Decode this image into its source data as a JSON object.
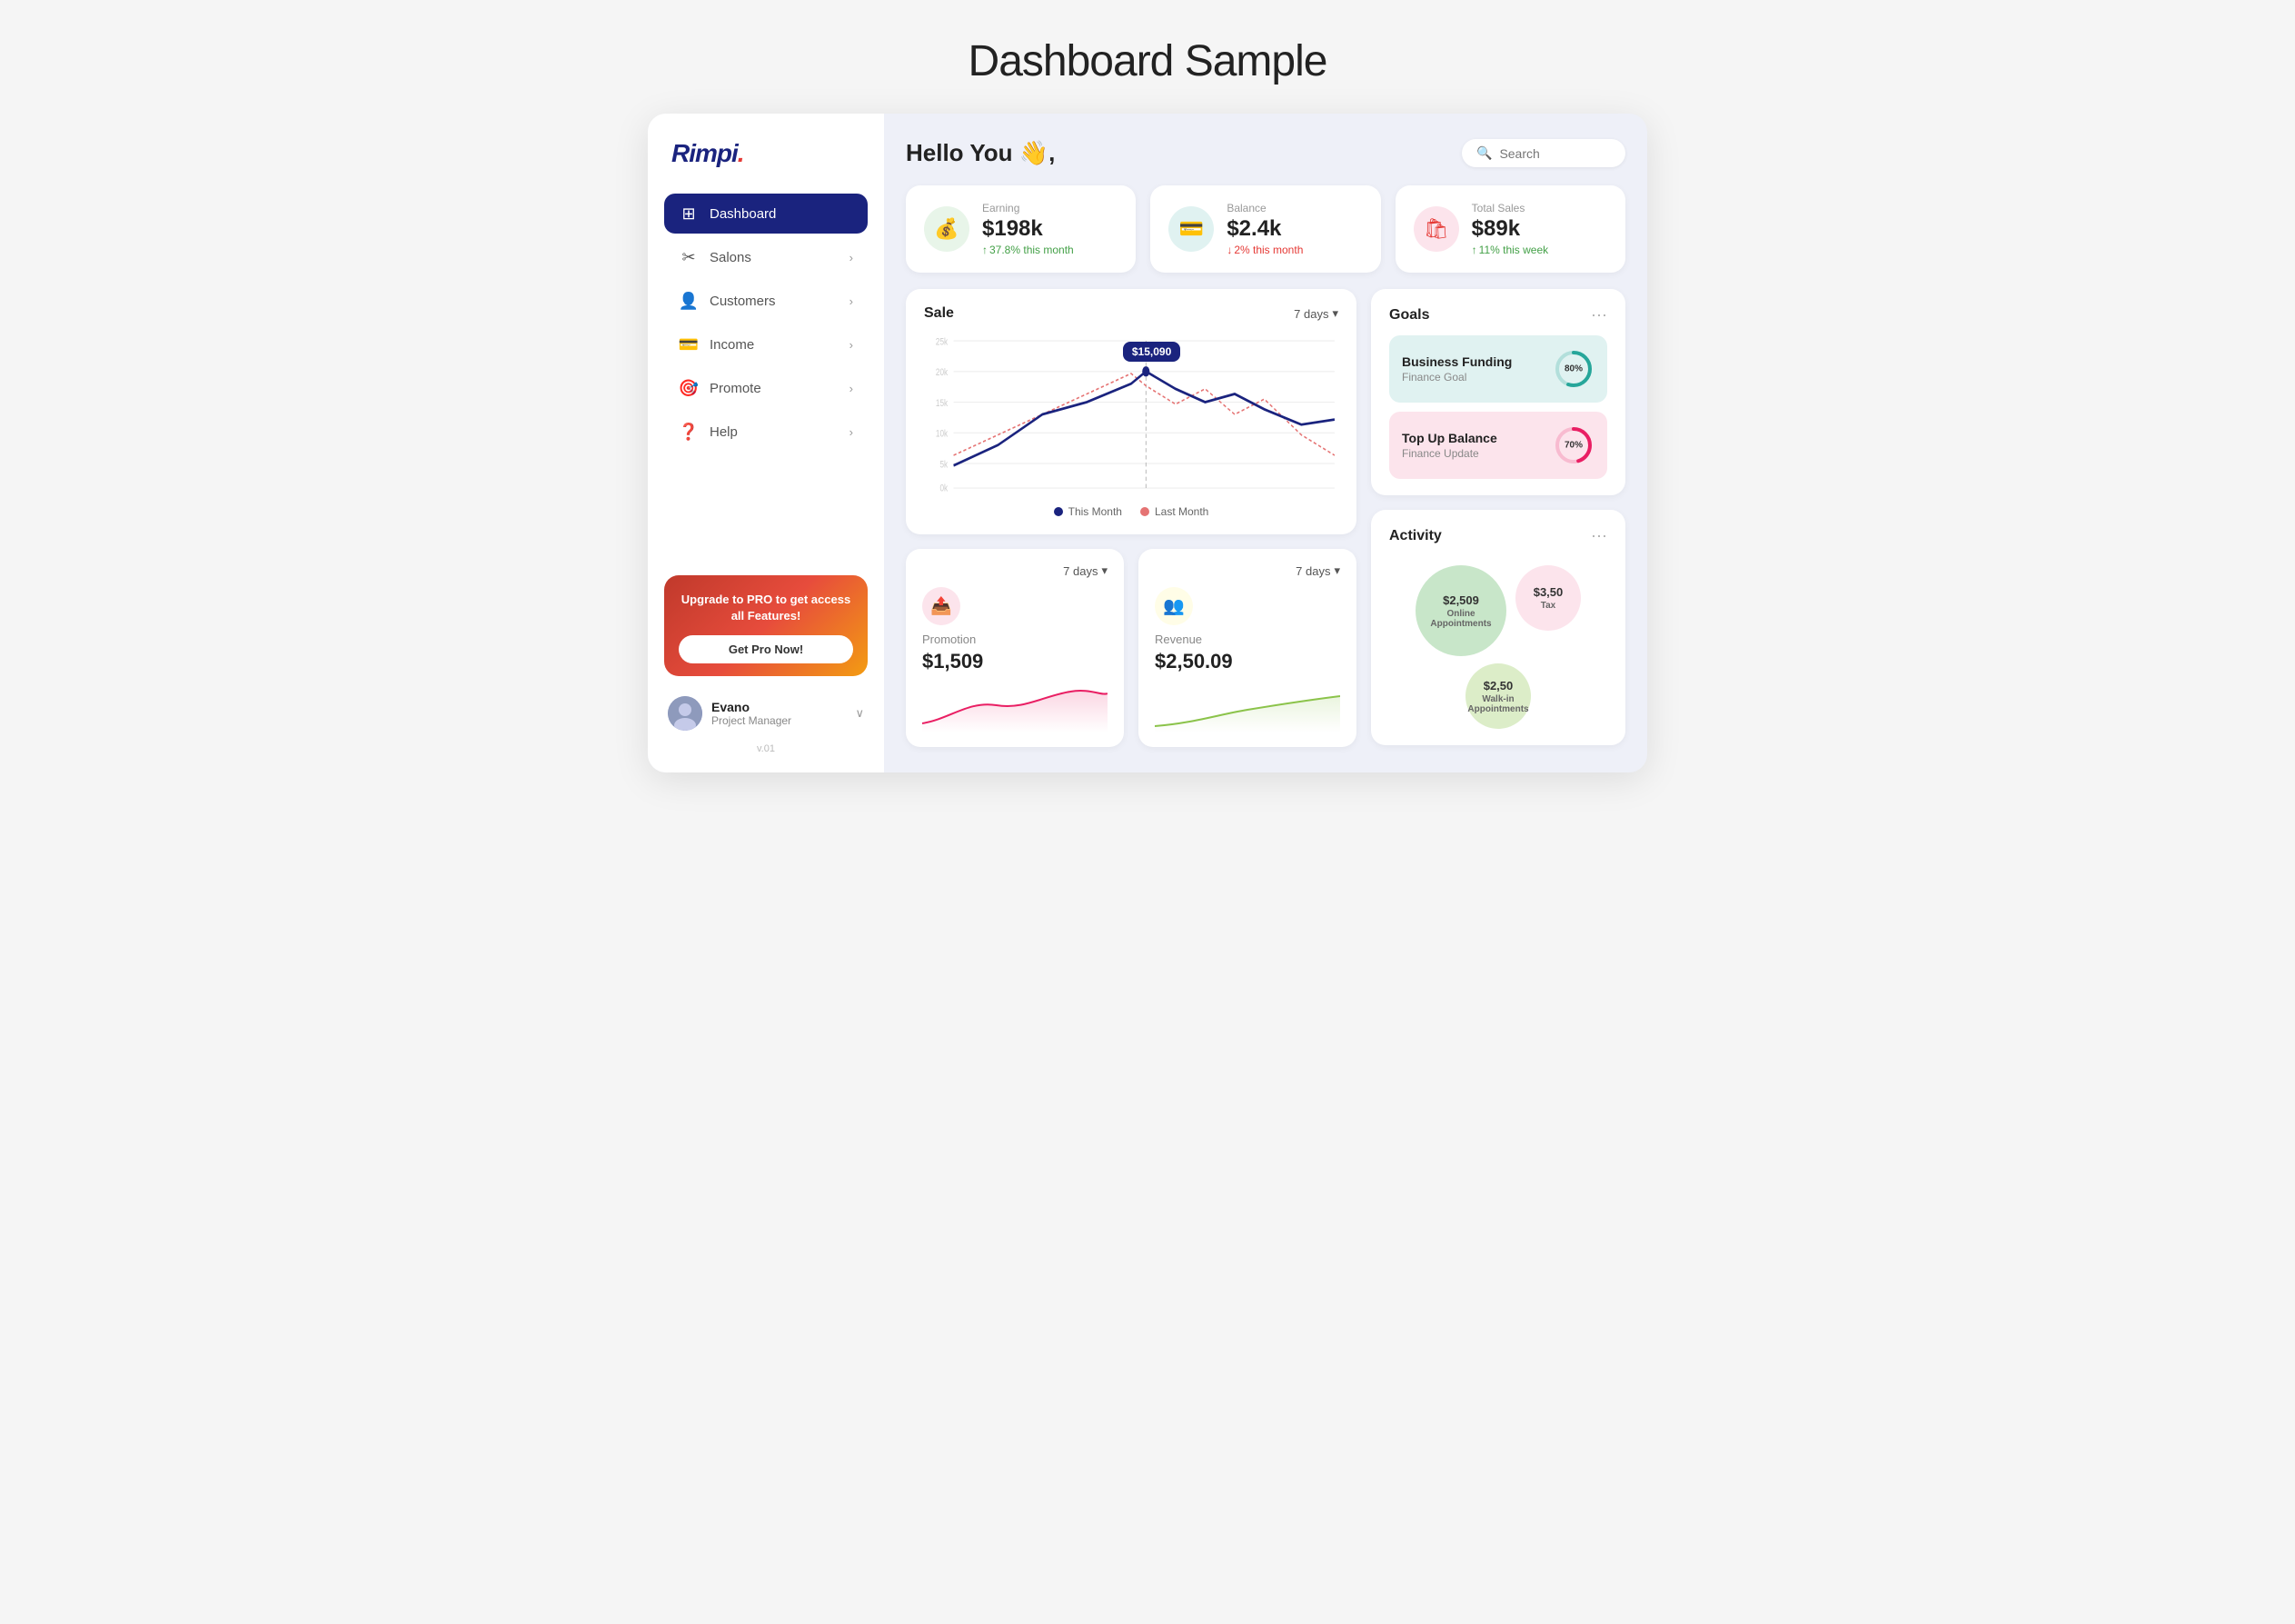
{
  "page": {
    "title": "Dashboard Sample"
  },
  "sidebar": {
    "logo": "Rimpi",
    "nav_items": [
      {
        "id": "dashboard",
        "label": "Dashboard",
        "icon": "⊞",
        "active": true
      },
      {
        "id": "salons",
        "label": "Salons",
        "icon": "✂",
        "active": false
      },
      {
        "id": "customers",
        "label": "Customers",
        "icon": "👤",
        "active": false
      },
      {
        "id": "income",
        "label": "Income",
        "icon": "💳",
        "active": false
      },
      {
        "id": "promote",
        "label": "Promote",
        "icon": "🎯",
        "active": false
      },
      {
        "id": "help",
        "label": "Help",
        "icon": "❓",
        "active": false
      }
    ],
    "upgrade": {
      "text": "Upgrade to PRO to get access all Features!",
      "button_label": "Get Pro Now!"
    },
    "user": {
      "name": "Evano",
      "role": "Project Manager"
    },
    "version": "v.01"
  },
  "header": {
    "greeting": "Hello You 👋,",
    "search_placeholder": "Search"
  },
  "stats": [
    {
      "label": "Earning",
      "value": "$198k",
      "change": "37.8% this month",
      "direction": "up",
      "icon": "💰",
      "icon_style": "green"
    },
    {
      "label": "Balance",
      "value": "$2.4k",
      "change": "2% this month",
      "direction": "down",
      "icon": "💳",
      "icon_style": "teal"
    },
    {
      "label": "Total Sales",
      "value": "$89k",
      "change": "11% this week",
      "direction": "up",
      "icon": "🛍",
      "icon_style": "orange"
    }
  ],
  "sale_chart": {
    "title": "Sale",
    "filter": "7 days",
    "tooltip_value": "$15,090",
    "legend": [
      {
        "label": "This Month",
        "color": "navy"
      },
      {
        "label": "Last Month",
        "color": "red"
      }
    ],
    "y_labels": [
      "25k",
      "20k",
      "15k",
      "10k",
      "5k",
      "0k"
    ]
  },
  "goals": {
    "title": "Goals",
    "items": [
      {
        "title": "Business Funding",
        "subtitle": "Finance Goal",
        "percent": 80,
        "color": "#26a69a",
        "bg": "teal-bg"
      },
      {
        "title": "Top Up Balance",
        "subtitle": "Finance Update",
        "percent": 70,
        "color": "#e91e63",
        "bg": "pink-bg"
      }
    ]
  },
  "activity": {
    "title": "Activity",
    "bubbles": [
      {
        "label": "Online Appointments",
        "amount": "$2,509",
        "size": "large",
        "color": "green-bubble"
      },
      {
        "label": "Tax",
        "amount": "$3,50",
        "size": "medium",
        "color": "pink-bubble"
      },
      {
        "label": "Walk-in Appointments",
        "amount": "$2,50",
        "size": "medium",
        "color": "light-green"
      }
    ]
  },
  "bottom_cards": [
    {
      "label": "Promotion",
      "value": "$1,509",
      "filter": "7 days",
      "icon": "📤",
      "icon_style": "pink",
      "chart_color": "#e91e63"
    },
    {
      "label": "Revenue",
      "value": "$2,50.09",
      "filter": "7 days",
      "icon": "👥",
      "icon_style": "yellow",
      "chart_color": "#8bc34a"
    }
  ]
}
